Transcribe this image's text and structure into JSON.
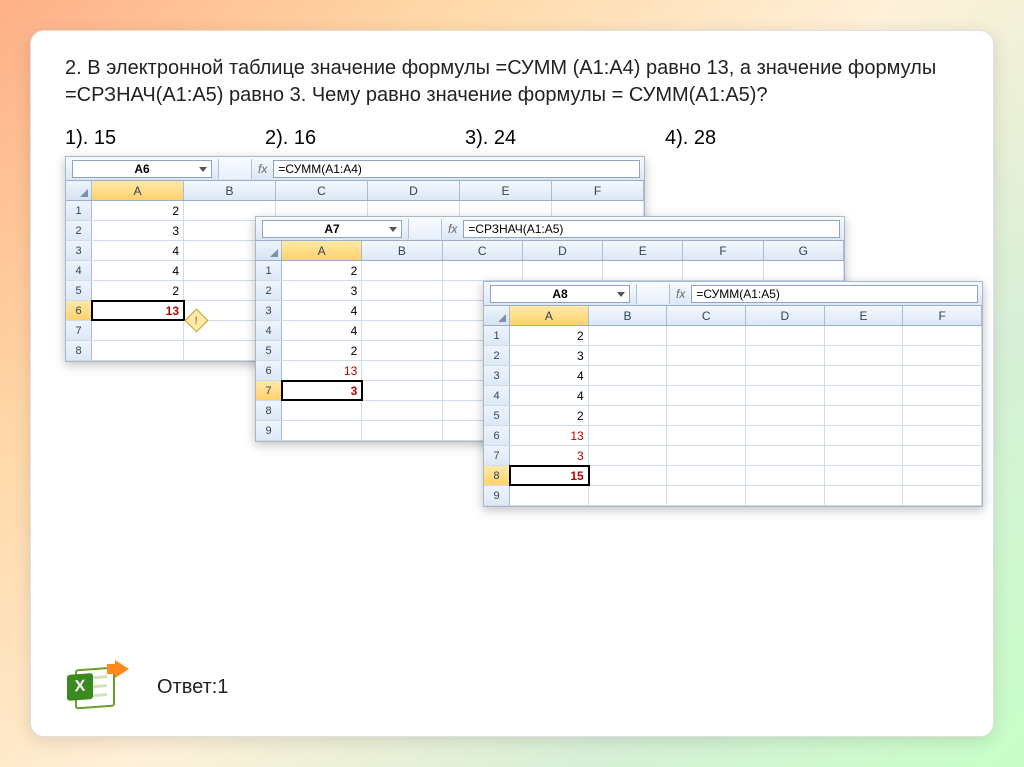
{
  "question": "2. В электронной таблице значение формулы  =СУММ (A1:A4) равно 13, а значение формулы =СРЗНАЧ(A1:A5) равно 3. Чему равно значение формулы = СУММ(А1:А5)?",
  "options": {
    "o1": "1). 15",
    "o2": "2). 16",
    "o3": "3). 24",
    "o4": "4). 28"
  },
  "answer": "Ответ:1",
  "sheet1": {
    "name_box": "A6",
    "fx": "fx",
    "formula": "=СУММ(A1:A4)",
    "cols": [
      "A",
      "B",
      "C",
      "D",
      "E",
      "F"
    ],
    "rows": [
      {
        "n": "1",
        "a": "2"
      },
      {
        "n": "2",
        "a": "3"
      },
      {
        "n": "3",
        "a": "4"
      },
      {
        "n": "4",
        "a": "4"
      },
      {
        "n": "5",
        "a": "2"
      },
      {
        "n": "6",
        "a": "13",
        "red": true,
        "sel": true
      },
      {
        "n": "7",
        "a": ""
      },
      {
        "n": "8",
        "a": ""
      }
    ],
    "warn": "!"
  },
  "sheet2": {
    "name_box": "A7",
    "fx": "fx",
    "formula": "=СРЗНАЧ(A1:A5)",
    "cols": [
      "A",
      "B",
      "C",
      "D",
      "E",
      "F",
      "G"
    ],
    "rows": [
      {
        "n": "1",
        "a": "2"
      },
      {
        "n": "2",
        "a": "3"
      },
      {
        "n": "3",
        "a": "4"
      },
      {
        "n": "4",
        "a": "4"
      },
      {
        "n": "5",
        "a": "2"
      },
      {
        "n": "6",
        "a": "13",
        "red": true
      },
      {
        "n": "7",
        "a": "3",
        "red": true,
        "sel": true
      },
      {
        "n": "8",
        "a": ""
      },
      {
        "n": "9",
        "a": ""
      }
    ]
  },
  "sheet3": {
    "name_box": "A8",
    "fx": "fx",
    "formula": "=СУММ(A1:A5)",
    "cols": [
      "A",
      "B",
      "C",
      "D",
      "E",
      "F"
    ],
    "rows": [
      {
        "n": "1",
        "a": "2"
      },
      {
        "n": "2",
        "a": "3"
      },
      {
        "n": "3",
        "a": "4"
      },
      {
        "n": "4",
        "a": "4"
      },
      {
        "n": "5",
        "a": "2"
      },
      {
        "n": "6",
        "a": "13",
        "red": true
      },
      {
        "n": "7",
        "a": "3",
        "red": true
      },
      {
        "n": "8",
        "a": "15",
        "red": true,
        "sel": true
      },
      {
        "n": "9",
        "a": ""
      }
    ]
  }
}
